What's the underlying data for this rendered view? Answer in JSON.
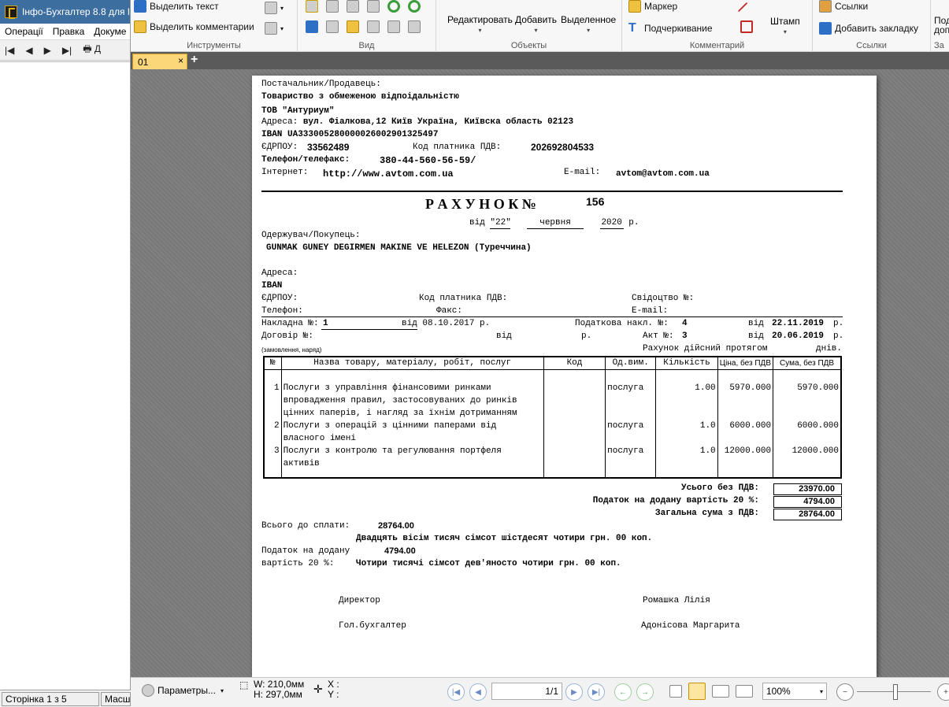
{
  "left_app": {
    "title": "Інфо-Бухгалтер 8.8 для I",
    "menu": [
      "Операції",
      "Правка",
      "Докуме"
    ],
    "toolbar": [
      "|◀",
      "◀",
      "▶",
      "▶|",
      "🖶 Д"
    ],
    "status": {
      "page": "Сторінка 1 з 5",
      "scale": "Масш"
    }
  },
  "ribbon": {
    "tools": {
      "select_text": "Выделить текст",
      "select_comments": "Выделить комментарии",
      "label": "Инструменты"
    },
    "view": {
      "label": "Вид"
    },
    "objects": {
      "edit": "Редактировать",
      "add": "Добавить",
      "selected": "Выделенное",
      "label": "Объекты"
    },
    "comments": {
      "marker": "Маркер",
      "underline": "Подчеркивание",
      "stamp": "Штамп",
      "label": "Комментарий"
    },
    "links": {
      "links": "Ссылки",
      "add_bookmark": "Добавить закладку",
      "label": "Ссылки"
    },
    "extra": {
      "line1": "Под",
      "line2": "доп",
      "label": "За"
    }
  },
  "tabs": {
    "doc_tab": "01",
    "close": "×",
    "add": "+"
  },
  "invoice": {
    "supplier_label": "Постачальник/Продавець:",
    "supplier_name1": "Товариство з обмеженою відпоідальністю",
    "supplier_name2": "ТОВ \"Антуриум\"",
    "address_label": "Адреса:",
    "address": "вул. Фіалкова,12 Київ Україна, Київска область 02123",
    "iban": "IBAN UA333005280000026002901325497",
    "edrpou_label": "ЄДРПОУ:",
    "edrpou": "33562489",
    "vat_code_label": "Код платника ПДВ:",
    "vat_code": "202692804533",
    "phone_label": "Телефон/телефакс:",
    "phone": "380-44-560-56-59/",
    "internet_label": "Інтернет:",
    "internet": "http://www.avtom.com.ua",
    "email_label": "E-mail:",
    "email": "avtom@avtom.com.ua",
    "title": "Р А Х У Н О К №",
    "number": "156",
    "date_from": "від",
    "date_day": "\"22\"",
    "date_month": "червня",
    "date_year": "2020",
    "date_suffix": "р.",
    "buyer_label": "Одержувач/Покупець:",
    "buyer_name": "GUNMAK GUNEY DEGIRMEN MAKINE VE HELEZON (Туреччина)",
    "b_address": "Адреса:",
    "b_iban": "IBAN",
    "b_edrpou": "ЄДРПОУ:",
    "b_vat": "Код платника ПДВ:",
    "b_cert": "Свідоцтво №:",
    "b_phone": "Телефон:",
    "b_fax": "Факс:",
    "b_email": "E-mail:",
    "waybill_label": "Накладна №:",
    "waybill_no": "1",
    "waybill_date": "від 08.10.2017 р.",
    "tax_invoice_label": "Податкова накл. №:",
    "tax_invoice_no": "4",
    "tax_invoice_from": "від",
    "tax_invoice_date": "22.11.2019",
    "tax_invoice_r": "р.",
    "contract_label": "Договір №:",
    "contract_from": "від",
    "contract_r": "р.",
    "act_label": "Акт №:",
    "act_no": "3",
    "act_from": "від",
    "act_date": "20.06.2019",
    "act_r": "р.",
    "order_note": "(замовлення, наряд)",
    "valid_label": "Рахунок дійсний протягом",
    "valid_days": "днів.",
    "columns": [
      "№",
      "Назва товару, матеріалу, робіт, послуг",
      "Код",
      "Од.вим.",
      "Кількість",
      "Ціна, без ПДВ",
      "Сума, без ПДВ"
    ],
    "rows": [
      {
        "n": "1",
        "name": [
          "Послуги з управління фінансовими ринками",
          "впровадження правил, застосовуваних до ринків",
          "цінних паперів, і нагляд за їхнім дотриманням"
        ],
        "code": "",
        "unit": "послуга",
        "qty": "1.00",
        "price": "5970.000",
        "sum": "5970.000"
      },
      {
        "n": "2",
        "name": [
          "Послуги з операцій з цінними паперами від",
          "власного імені"
        ],
        "code": "",
        "unit": "послуга",
        "qty": "1.0",
        "price": "6000.000",
        "sum": "6000.000"
      },
      {
        "n": "3",
        "name": [
          "Послуги з контролю та регулювання портфеля",
          "активів"
        ],
        "code": "",
        "unit": "послуга",
        "qty": "1.0",
        "price": "12000.000",
        "sum": "12000.000"
      }
    ],
    "total_no_vat_label": "Усього без ПДВ:",
    "total_no_vat": "23970.00",
    "vat_label": "Податок на додану вартість 20 %:",
    "vat": "4794.00",
    "total_label": "Загальна сума з ПДВ:",
    "total": "28764.00",
    "to_pay_label": "Всього до сплати:",
    "to_pay": "28764.00",
    "to_pay_words": "Двадцять вісім тисяч сімсот шістдесят чотири грн. 00 коп.",
    "vat_line_label1": "Податок на додану",
    "vat_line_value": "4794.00",
    "vat_line_label2": "вартість 20 %:",
    "vat_words": "Чотири тисячі сімсот дев'яносто чотири грн. 00 коп.",
    "director_label": "Директор",
    "director_name": "Ромашка Лілія",
    "accountant_label": "Гол.бухгалтер",
    "accountant_name": "Адонісова Маргарита"
  },
  "bottom": {
    "params": "Параметры...",
    "width": "W: 210,0мм",
    "height": "H: 297,0мм",
    "x": "X :",
    "y": "Y :",
    "page": "1/1",
    "zoom": "100%"
  }
}
